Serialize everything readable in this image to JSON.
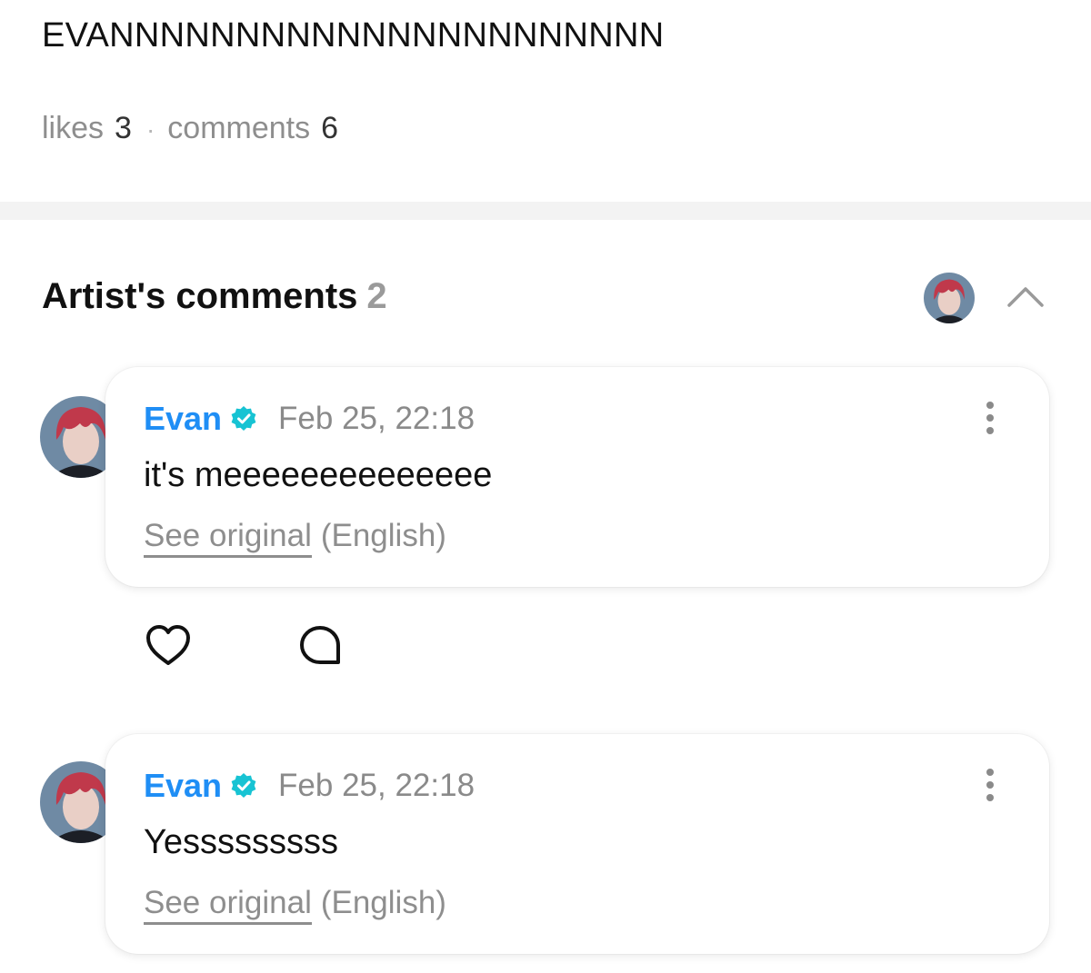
{
  "post": {
    "title": "EVANNNNNNNNNNNNNNNNNNNNNN",
    "likes_label": "likes",
    "likes_count": "3",
    "separator": "·",
    "comments_label": "comments",
    "comments_count": "6"
  },
  "artist_comments": {
    "title": "Artist's comments",
    "count": "2",
    "collapse_icon": "chevron-up-icon",
    "items": [
      {
        "author": "Evan",
        "verified_icon": "verified-badge-icon",
        "date": "Feb 25, 22:18",
        "text": "it's meeeeeeeeeeeeee",
        "see_original": "See original",
        "language": "(English)",
        "more_icon": "more-vertical-icon"
      },
      {
        "author": "Evan",
        "verified_icon": "verified-badge-icon",
        "date": "Feb 25, 22:18",
        "text": "Yesssssssss",
        "see_original": "See original",
        "language": "(English)",
        "more_icon": "more-vertical-icon"
      }
    ]
  },
  "actions": {
    "like_icon": "heart-icon",
    "reply_icon": "comment-bubble-icon"
  },
  "colors": {
    "author": "#1f8ef5",
    "verified_badge": "#17c3d3",
    "muted_text": "#8e8e8e",
    "divider": "#f3f3f3",
    "avatar_hair": "#c0394b",
    "avatar_bg": "#6f8aa4"
  }
}
